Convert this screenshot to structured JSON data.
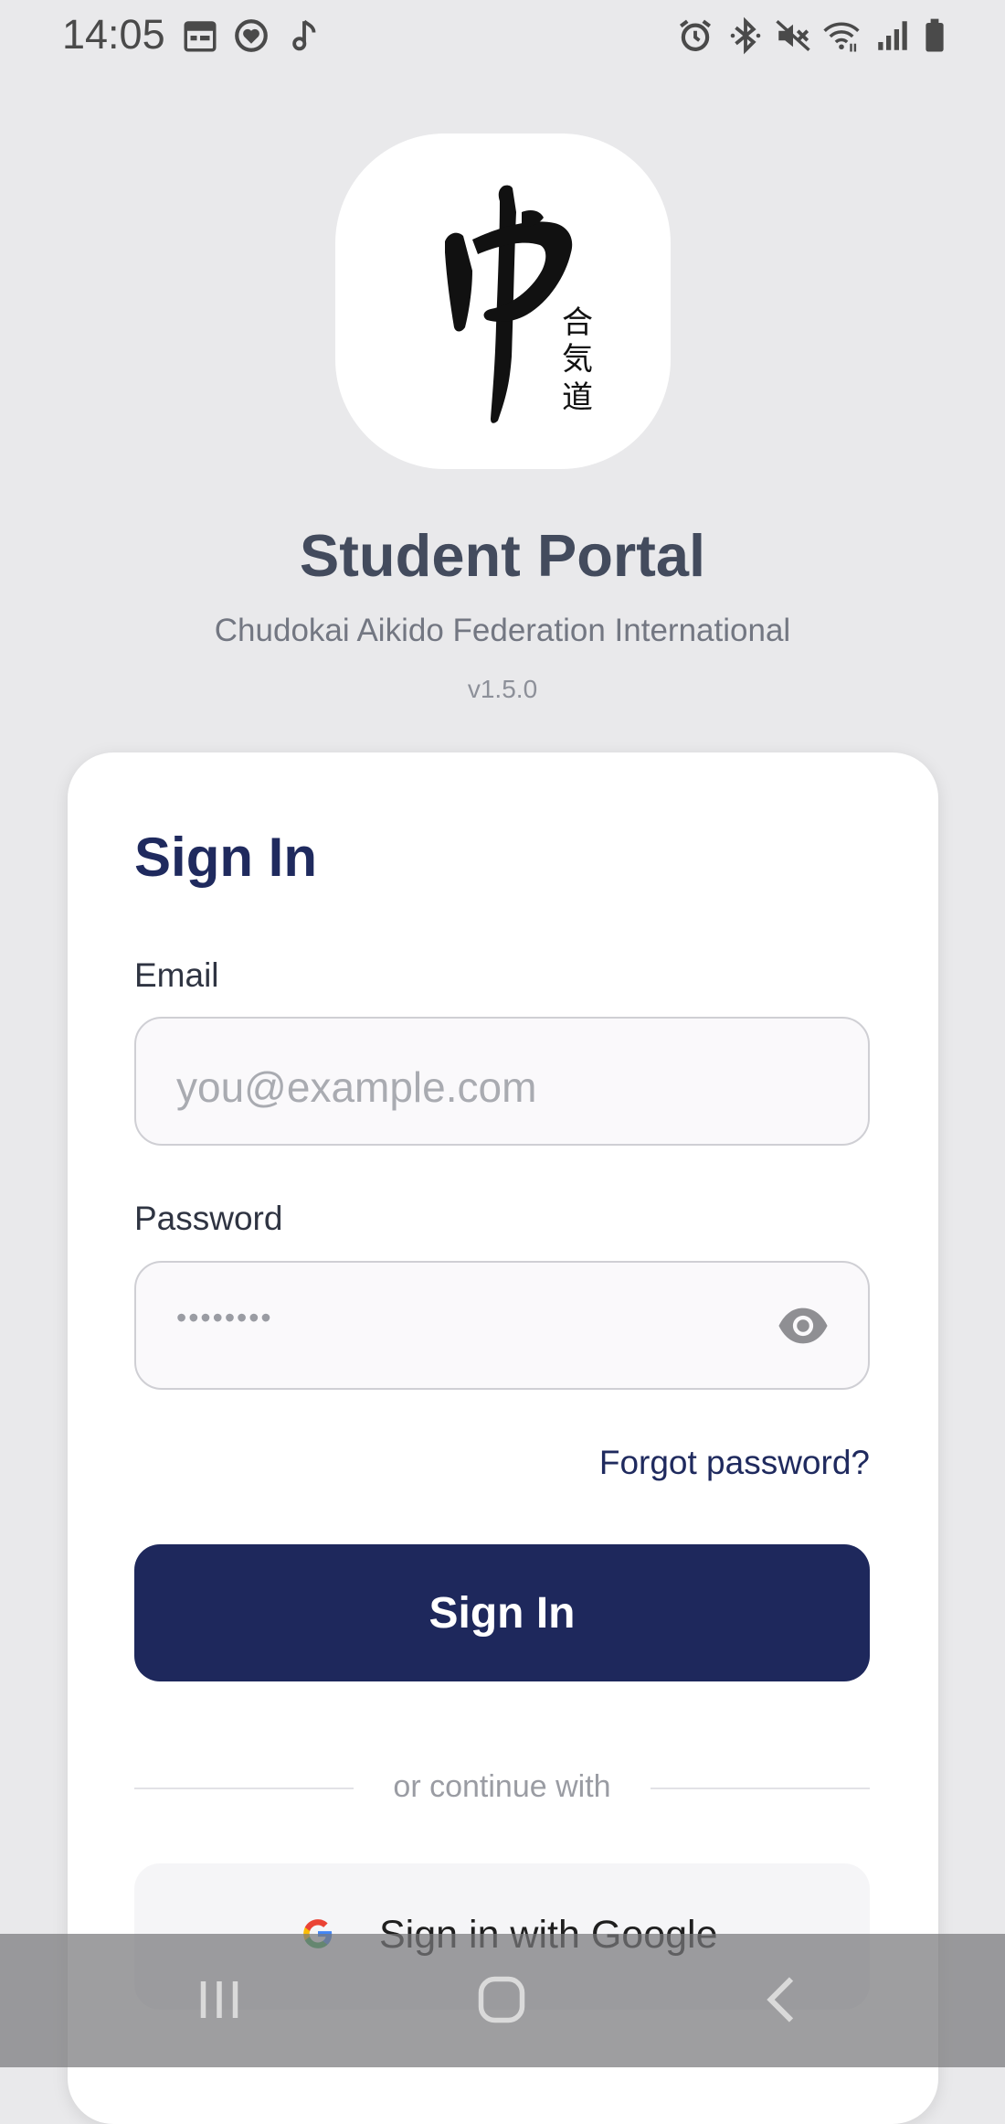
{
  "status_bar": {
    "time": "14:05",
    "left_icons": [
      "calendar-icon",
      "heart-rate-icon",
      "music-note-icon"
    ],
    "right_icons": [
      "alarm-icon",
      "bluetooth-icon",
      "mute-icon",
      "wifi-icon",
      "signal-icon",
      "battery-icon"
    ]
  },
  "header": {
    "logo_icon": "aikido-calligraphy-logo",
    "title": "Student Portal",
    "subtitle": "Chudokai Aikido Federation International",
    "version": "v1.5.0"
  },
  "signin_card": {
    "title": "Sign In",
    "email": {
      "label": "Email",
      "placeholder": "you@example.com",
      "value": ""
    },
    "password": {
      "label": "Password",
      "masked_value": "••••••••",
      "toggle_icon": "eye-icon"
    },
    "forgot_link": "Forgot password?",
    "submit_label": "Sign In",
    "divider_text": "or continue with",
    "google": {
      "icon": "google-icon",
      "label": "Sign in with Google"
    }
  },
  "colors": {
    "background": "#e9e9eb",
    "primary": "#1e285c",
    "title_text": "#434b5d",
    "card": "#ffffff"
  },
  "nav_bar": {
    "buttons": [
      "recents-icon",
      "home-icon",
      "back-icon"
    ]
  }
}
